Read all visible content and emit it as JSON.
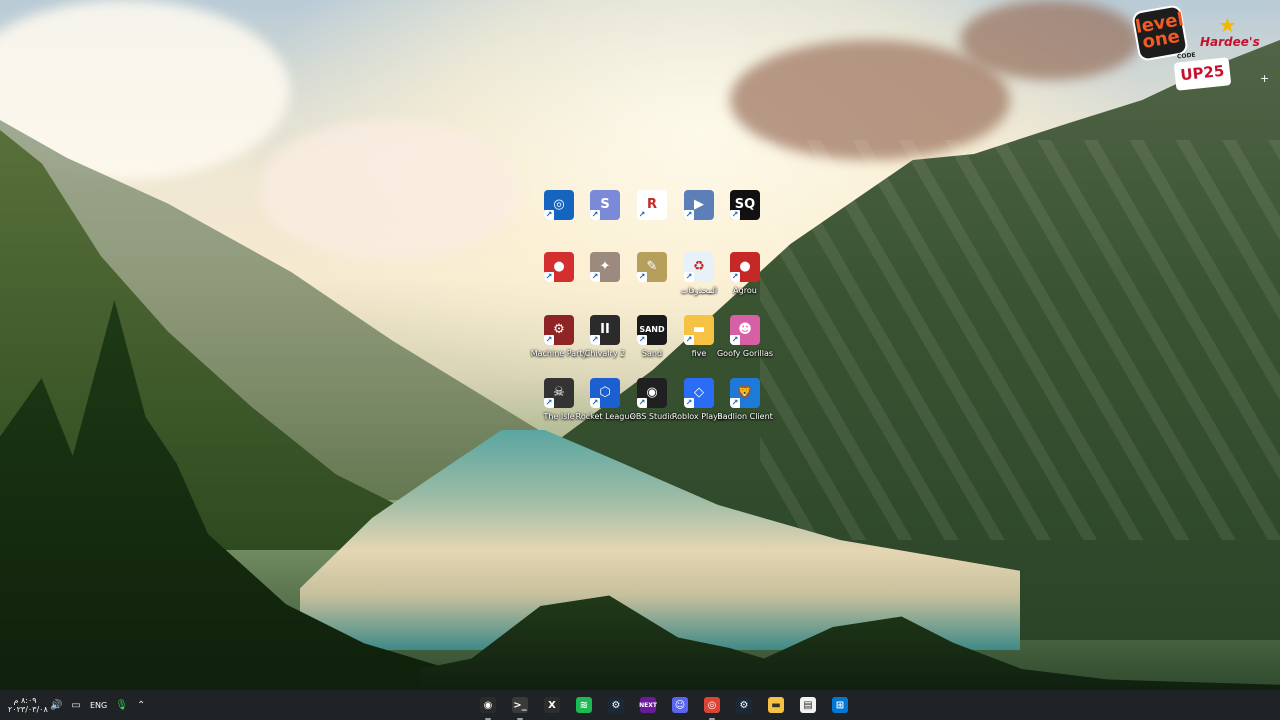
{
  "desktop": {
    "promo": {
      "level_one_text_top": "level",
      "level_one_text_bottom": "one",
      "brand": "Hardee's",
      "code_caption": "CODE",
      "code_value": "UP25",
      "plus": "+"
    },
    "icons": [
      {
        "label": "",
        "icon": "blue-camera-app-icon",
        "color": "#1565c0",
        "glyph": "◎"
      },
      {
        "label": "",
        "icon": "red-lightning-app-icon",
        "color": "#7b8ad8",
        "glyph": "S"
      },
      {
        "label": "",
        "icon": "red-r-app-icon",
        "color": "#ffffff",
        "glyph": "R"
      },
      {
        "label": "",
        "icon": "truck-app-icon",
        "color": "#5d7fb8",
        "glyph": "▶"
      },
      {
        "label": "",
        "icon": "sq-app-icon",
        "color": "#111111",
        "glyph": "SQ"
      },
      {
        "label": "",
        "icon": "red-car-app-icon",
        "color": "#d32f2f",
        "glyph": "●"
      },
      {
        "label": "",
        "icon": "figure-app-icon",
        "color": "#9b8a7d",
        "glyph": "✦"
      },
      {
        "label": "",
        "icon": "sketch-app-icon",
        "color": "#b59f5a",
        "glyph": "✎"
      },
      {
        "label": "المحذوفات",
        "icon": "recycle-bin-icon",
        "color": "#e8f0f8",
        "glyph": "♻"
      },
      {
        "label": "Agrou",
        "icon": "agrou-app-icon",
        "color": "#c62828",
        "glyph": "●"
      },
      {
        "label": "Machine Party",
        "icon": "machine-party-app-icon",
        "color": "#8e2424",
        "glyph": "⚙"
      },
      {
        "label": "Chivalry 2",
        "icon": "chivalry-app-icon",
        "color": "#2b2b2b",
        "glyph": "II"
      },
      {
        "label": "Sand",
        "icon": "sand-app-icon",
        "color": "#1a1a1a",
        "glyph": "SAND"
      },
      {
        "label": "five",
        "icon": "folder-icon",
        "color": "#f6c244",
        "glyph": "▬"
      },
      {
        "label": "Goofy Gorillas",
        "icon": "goofy-gorillas-app-icon",
        "color": "#d75fa5",
        "glyph": "☻"
      },
      {
        "label": "The Isle",
        "icon": "the-isle-app-icon",
        "color": "#333333",
        "glyph": "☠"
      },
      {
        "label": "Rocket League",
        "icon": "rocket-league-app-icon",
        "color": "#1b5fd1",
        "glyph": "⬡"
      },
      {
        "label": "OBS Studio",
        "icon": "obs-studio-app-icon",
        "color": "#202020",
        "glyph": "◉"
      },
      {
        "label": "Roblox Player",
        "icon": "roblox-app-icon",
        "color": "#2a6df4",
        "glyph": "◇"
      },
      {
        "label": "Badlion Client",
        "icon": "badlion-client-app-icon",
        "color": "#1d7ad8",
        "glyph": "🦁"
      }
    ]
  },
  "taskbar": {
    "clock_time": "٨:٠٩ م",
    "clock_date": "٢٠٢٣/٠٣/٠٨",
    "language": "ENG",
    "tray_icons": [
      "volume-icon",
      "display-icon",
      "microphone-icon",
      "chevron-up-icon"
    ],
    "apps": [
      {
        "name": "recorder-icon",
        "color": "#2b2b2b",
        "glyph": "◉",
        "active": true
      },
      {
        "name": "terminal-icon",
        "color": "#3a3a3a",
        "glyph": ">_",
        "active": true
      },
      {
        "name": "xbox-icon",
        "color": "#2d2d2d",
        "glyph": "X",
        "active": false
      },
      {
        "name": "spotify-icon",
        "color": "#1db954",
        "glyph": "≋",
        "active": false
      },
      {
        "name": "steam-icon",
        "color": "#1b2838",
        "glyph": "⚙",
        "active": false
      },
      {
        "name": "next-icon",
        "color": "#6a1b9a",
        "glyph": "NEXT",
        "active": false
      },
      {
        "name": "discord-icon",
        "color": "#5865f2",
        "glyph": "☺",
        "active": false
      },
      {
        "name": "chrome-icon",
        "color": "#db4437",
        "glyph": "◎",
        "active": true
      },
      {
        "name": "steam-2-icon",
        "color": "#1b2838",
        "glyph": "⚙",
        "active": false
      },
      {
        "name": "file-explorer-icon",
        "color": "#f6c244",
        "glyph": "▬",
        "active": false
      },
      {
        "name": "notepad-icon",
        "color": "#f2f2f2",
        "glyph": "▤",
        "active": false
      },
      {
        "name": "start-icon",
        "color": "#0078d4",
        "glyph": "⊞",
        "active": false
      }
    ]
  }
}
